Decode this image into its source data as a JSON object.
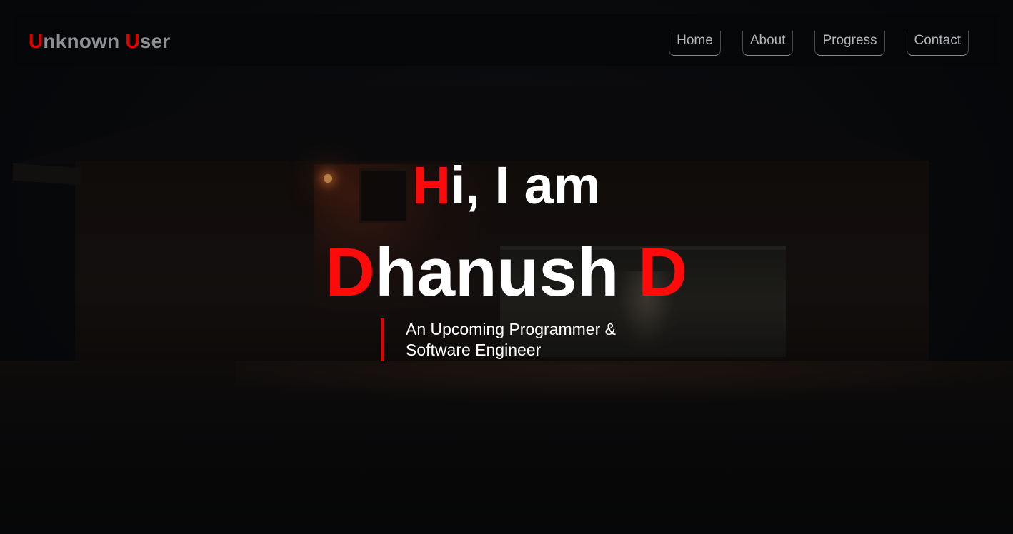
{
  "brand": {
    "first_initial": "U",
    "first_rest": "nknown",
    "second_initial": "U",
    "second_rest": "ser"
  },
  "nav": {
    "items": [
      "Home",
      "About",
      "Progress",
      "Contact"
    ]
  },
  "hero": {
    "greeting_initial": "H",
    "greeting_rest": "i, I am",
    "name_first_initial": "D",
    "name_first_rest": "hanush",
    "name_last": "D",
    "tagline_line1": "An Upcoming Programmer &",
    "tagline_line2": "Software Engineer"
  },
  "colors": {
    "accent": "#ff0a0a",
    "brand_text": "#8f8f94",
    "nav_text": "#b4b4b8",
    "hero_text": "#ffffff",
    "background": "#07090b"
  }
}
